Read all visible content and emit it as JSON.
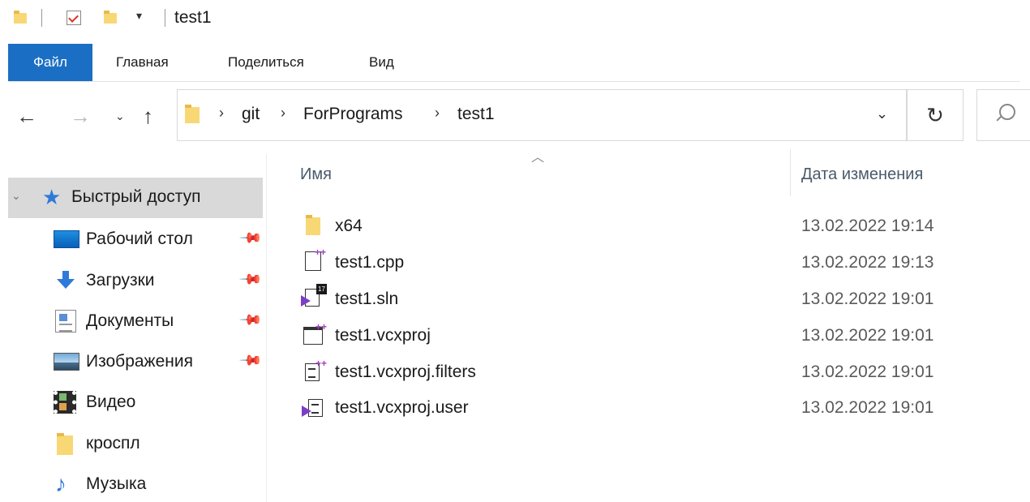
{
  "titlebar": {
    "title": "test1"
  },
  "ribbon": {
    "tabs": [
      "Файл",
      "Главная",
      "Поделиться",
      "Вид"
    ]
  },
  "address": {
    "breadcrumbs": [
      "git",
      "ForPrograms",
      "test1"
    ]
  },
  "sidebar": {
    "quick_access": "Быстрый доступ",
    "items": [
      {
        "label": "Рабочий стол",
        "icon": "desktop-icon",
        "pinned": true
      },
      {
        "label": "Загрузки",
        "icon": "download-icon",
        "pinned": true
      },
      {
        "label": "Документы",
        "icon": "documents-icon",
        "pinned": true
      },
      {
        "label": "Изображения",
        "icon": "pictures-icon",
        "pinned": true
      },
      {
        "label": "Видео",
        "icon": "video-icon",
        "pinned": false
      },
      {
        "label": "кроспл",
        "icon": "folder-icon",
        "pinned": false
      },
      {
        "label": "Музыка",
        "icon": "music-icon",
        "pinned": false
      }
    ]
  },
  "file_list": {
    "columns": {
      "name": "Имя",
      "date": "Дата изменения"
    },
    "rows": [
      {
        "name": "x64",
        "date": "13.02.2022 19:14",
        "icon": "folder-icon"
      },
      {
        "name": "test1.cpp",
        "date": "13.02.2022 19:13",
        "icon": "cpp-file-icon"
      },
      {
        "name": "test1.sln",
        "date": "13.02.2022 19:01",
        "icon": "vs-solution-icon",
        "badge": "17"
      },
      {
        "name": "test1.vcxproj",
        "date": "13.02.2022 19:01",
        "icon": "vcxproj-icon"
      },
      {
        "name": "test1.vcxproj.filters",
        "date": "13.02.2022 19:01",
        "icon": "filters-file-icon"
      },
      {
        "name": "test1.vcxproj.user",
        "date": "13.02.2022 19:01",
        "icon": "user-file-icon"
      }
    ]
  },
  "colors": {
    "accent": "#1a6fc4",
    "selection": "#d9d9d9",
    "folder": "#f8d775"
  }
}
